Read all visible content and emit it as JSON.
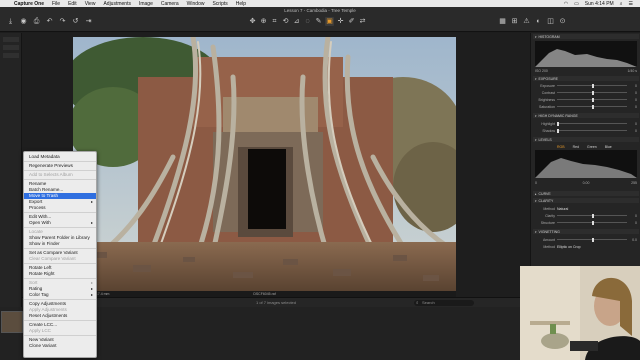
{
  "menubar": {
    "app": "Capture One",
    "items": [
      "File",
      "Edit",
      "View",
      "Adjustments",
      "Image",
      "Camera",
      "Window",
      "Scripts",
      "Help"
    ],
    "clock": "Sun 4:14 PM"
  },
  "window": {
    "title": "Lesson 7 - Cambodia - Tree Temple"
  },
  "viewer": {
    "iso": "ISO 200",
    "shutter": "17.4 mm",
    "filename": "DSCF6045.raf",
    "count": "1 of 7 images selected",
    "search_placeholder": "Search"
  },
  "context_menu": {
    "items": [
      {
        "label": "Load Metadata",
        "disabled": false
      },
      {
        "sep": true
      },
      {
        "label": "Regenerate Previews",
        "disabled": false
      },
      {
        "sep": true
      },
      {
        "label": "Add to Selects Album",
        "disabled": true
      },
      {
        "sep": true
      },
      {
        "label": "Rename",
        "disabled": false
      },
      {
        "label": "Batch Rename...",
        "disabled": false
      },
      {
        "label": "Move to Trash",
        "disabled": false,
        "highlighted": true
      },
      {
        "label": "Export",
        "disabled": false,
        "submenu": true
      },
      {
        "label": "Process",
        "disabled": false
      },
      {
        "sep": true
      },
      {
        "label": "Edit With...",
        "disabled": false
      },
      {
        "label": "Open With",
        "disabled": false,
        "submenu": true
      },
      {
        "sep": true
      },
      {
        "label": "Locate",
        "disabled": true
      },
      {
        "label": "Show Parent Folder in Library",
        "disabled": false
      },
      {
        "label": "Show in Finder",
        "disabled": false
      },
      {
        "sep": true
      },
      {
        "label": "Set as Compare Variant",
        "disabled": false
      },
      {
        "label": "Clear Compare Variant",
        "disabled": true
      },
      {
        "sep": true
      },
      {
        "label": "Rotate Left",
        "disabled": false
      },
      {
        "label": "Rotate Right",
        "disabled": false
      },
      {
        "sep": true
      },
      {
        "label": "Sort",
        "disabled": true,
        "submenu": true
      },
      {
        "label": "Rating",
        "disabled": false,
        "submenu": true
      },
      {
        "label": "Color Tag",
        "disabled": false,
        "submenu": true
      },
      {
        "sep": true
      },
      {
        "label": "Copy Adjustments",
        "disabled": false
      },
      {
        "label": "Apply Adjustments",
        "disabled": true
      },
      {
        "label": "Reset Adjustments",
        "disabled": false
      },
      {
        "sep": true
      },
      {
        "label": "Create LCC...",
        "disabled": false
      },
      {
        "label": "Apply LCC",
        "disabled": true
      },
      {
        "sep": true
      },
      {
        "label": "New Variant",
        "disabled": false
      },
      {
        "label": "Clone Variant",
        "disabled": false
      }
    ]
  },
  "tools_panel": {
    "histogram": "HISTOGRAM",
    "iso_info": "ISO 200",
    "shutter_info": "1/40 s",
    "exposure": {
      "title": "Exposure",
      "rows": [
        {
          "label": "Exposure",
          "value": "0"
        },
        {
          "label": "Contrast",
          "value": "0"
        },
        {
          "label": "Brightness",
          "value": "0"
        },
        {
          "label": "Saturation",
          "value": "0"
        }
      ]
    },
    "hdr": {
      "title": "High Dynamic Range",
      "rows": [
        {
          "label": "Highlight",
          "value": "0"
        },
        {
          "label": "Shadow",
          "value": "0"
        }
      ]
    },
    "levels": {
      "title": "Levels",
      "tabs": [
        "RGB",
        "Red",
        "Green",
        "Blue"
      ],
      "value_low": "0",
      "value_mid": "0.00",
      "value_high": "255"
    },
    "curve": {
      "title": "Curve"
    },
    "clarity": {
      "title": "Clarity",
      "method_label": "Method",
      "method_value": "Natural",
      "rows": [
        {
          "label": "Clarity",
          "value": "0"
        },
        {
          "label": "Structure",
          "value": "0"
        }
      ]
    },
    "vignetting": {
      "title": "Vignetting",
      "rows": [
        {
          "label": "Amount",
          "value": "0.0"
        }
      ],
      "method_label": "Method",
      "method_value": "Elliptic on Crop"
    }
  },
  "colors": {
    "accent": "#e79a2a",
    "highlight": "#2f6fe0"
  }
}
